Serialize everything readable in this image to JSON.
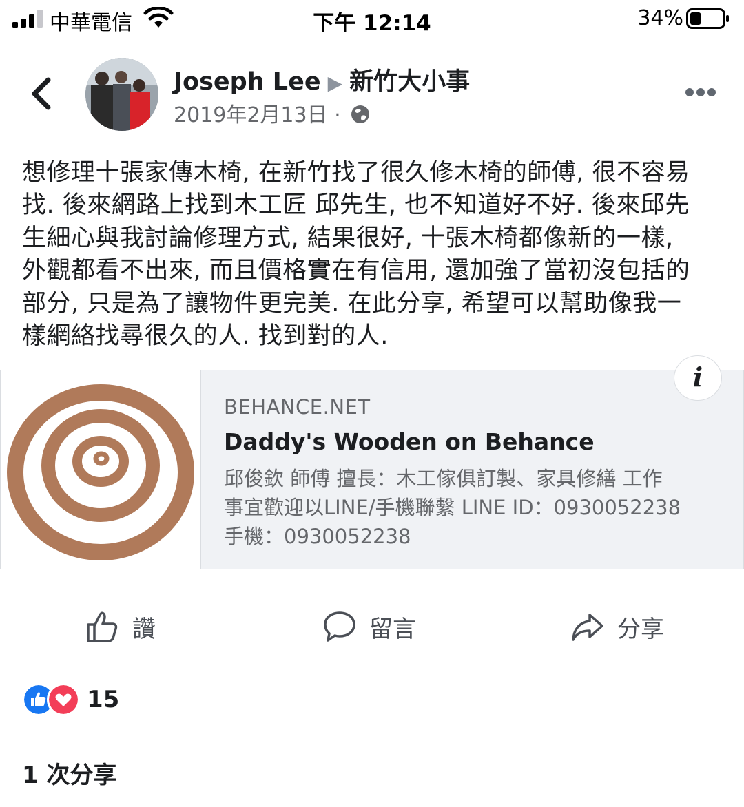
{
  "status_bar": {
    "carrier": "中華電信",
    "time": "下午 12:14",
    "battery_percent": "34%",
    "battery_level": 0.34
  },
  "post": {
    "author": "Joseph Lee",
    "group": "新竹大小事",
    "date": "2019年2月13日",
    "text_lines": [
      "想修理十張家傳木椅, 在新竹找了很久修木椅的師傅, 很不容易",
      "找. 後來網路上找到木工匠 邱先生, 也不知道好不好. 後來邱先",
      "生細心與我討論修理方式, 結果很好, 十張木椅都像新的一樣,",
      "外觀都看不出來, 而且價格實在有信用, 還加強了當初沒包括的",
      "部分, 只是為了讓物件更完美. 在此分享, 希望可以幫助像我一",
      "樣網絡找尋很久的人. 找到對的人."
    ]
  },
  "link_card": {
    "domain": "BEHANCE.NET",
    "title": "Daddy's Wooden on Behance",
    "description_lines": [
      "邱俊欽 師傅 擅長：木工傢俱訂製、家具修繕 工作",
      "事宜歡迎以LINE/手機聯繫 LINE ID：0930052238",
      "手機：0930052238"
    ],
    "info_icon": "i"
  },
  "actions": {
    "like": "讚",
    "comment": "留言",
    "share": "分享"
  },
  "reactions": {
    "count": "15",
    "icons": [
      "like-icon",
      "love-icon"
    ],
    "like_color": "#1877f2",
    "love_color": "#f33e58"
  },
  "shares": "1 次分享",
  "colors": {
    "thumbnail_ring": "#b07a5a",
    "secondary_text": "#65676b"
  }
}
